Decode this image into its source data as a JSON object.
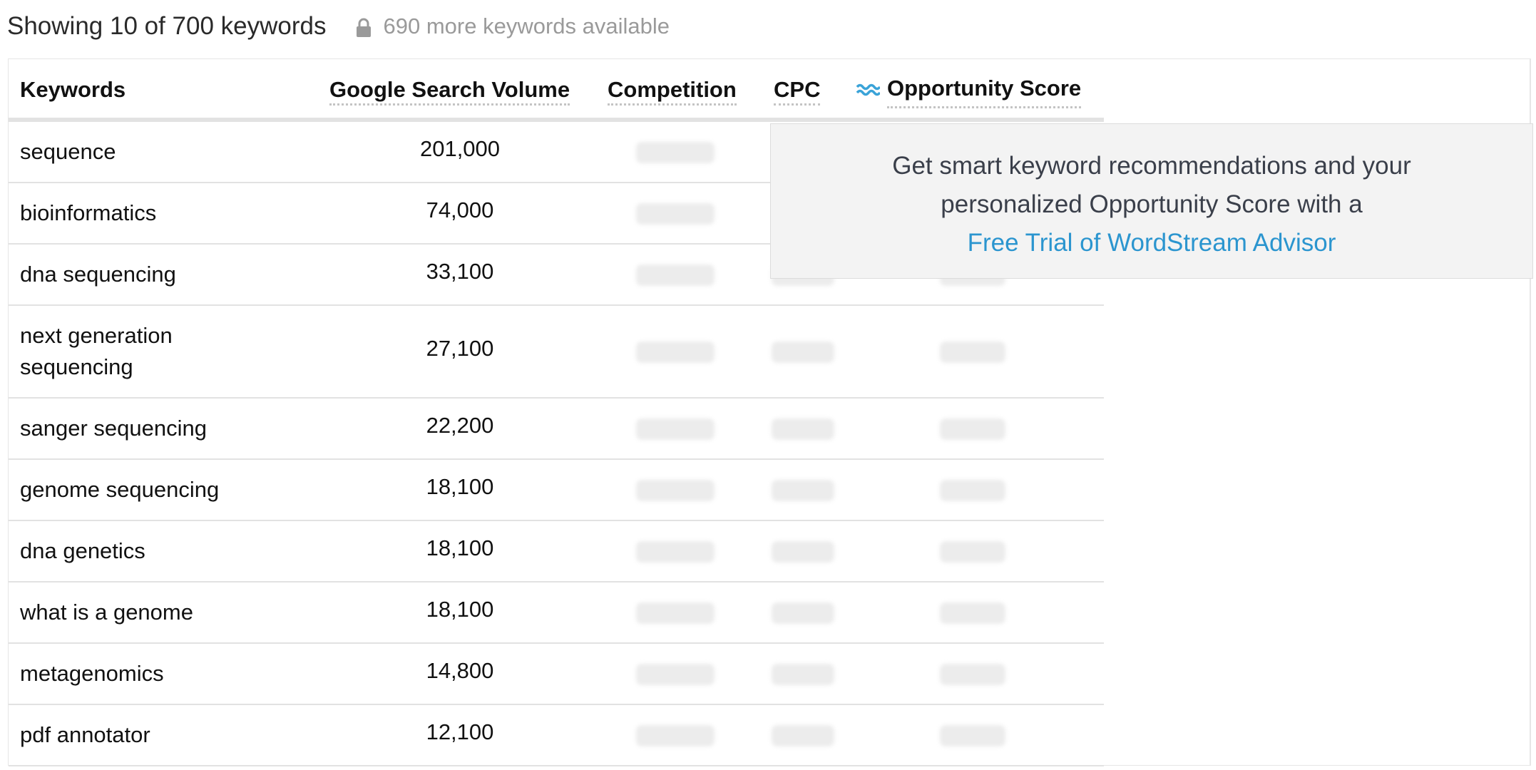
{
  "summary": {
    "title": "Showing 10 of 700 keywords",
    "lock_icon": "lock-icon",
    "more_text": "690 more keywords available"
  },
  "table": {
    "headers": {
      "keywords": "Keywords",
      "volume": "Google Search Volume",
      "competition": "Competition",
      "cpc": "CPC",
      "opportunity_icon": "wave-icon",
      "opportunity": "Opportunity Score"
    },
    "rows": [
      {
        "keyword": "sequence",
        "volume": "201,000"
      },
      {
        "keyword": "bioinformatics",
        "volume": "74,000"
      },
      {
        "keyword": "dna sequencing",
        "volume": "33,100"
      },
      {
        "keyword": "next generation sequencing",
        "volume": "27,100"
      },
      {
        "keyword": "sanger sequencing",
        "volume": "22,200"
      },
      {
        "keyword": "genome sequencing",
        "volume": "18,100"
      },
      {
        "keyword": "dna genetics",
        "volume": "18,100"
      },
      {
        "keyword": "what is a genome",
        "volume": "18,100"
      },
      {
        "keyword": "metagenomics",
        "volume": "14,800"
      },
      {
        "keyword": "pdf annotator",
        "volume": "12,100"
      }
    ]
  },
  "promo": {
    "line1": "Get smart keyword recommendations and your",
    "line2": "personalized Opportunity Score with a",
    "link": "Free Trial of WordStream Advisor"
  },
  "colors": {
    "link": "#2b95cf",
    "opportunity_icon": "#3aa3d8",
    "promo_bg": "#f3f3f3"
  }
}
